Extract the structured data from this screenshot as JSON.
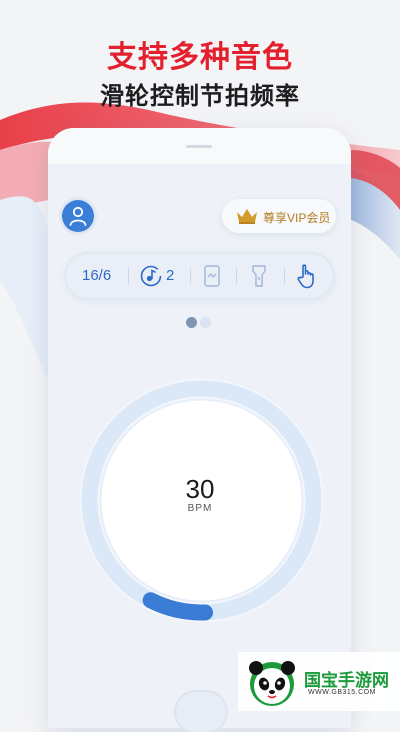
{
  "banner": {
    "title": "支持多种音色",
    "subtitle": "滑轮控制节拍频率"
  },
  "header": {
    "avatar_icon": "user-icon",
    "vip_icon": "crown-icon",
    "vip_label": "尊享VIP会员"
  },
  "toolbar": {
    "time_signature": "16/6",
    "subdivision_icon": "note-dial-icon",
    "subdivision_value": "2",
    "items": [
      "time-signature",
      "subdivision-icon",
      "vibrate-phone-icon",
      "flashlight-icon",
      "tap-hand-icon"
    ]
  },
  "pager": {
    "pages": 2,
    "active": 1
  },
  "metronome": {
    "bpm": "30",
    "unit": "BPM",
    "progress": 0.08
  },
  "watermark": {
    "name": "国宝手游网",
    "url": "WWW.GB315.COM"
  },
  "colors": {
    "accent": "#3b7ed8",
    "headline_red": "#e5202e",
    "vip_gold": "#b27c1c",
    "ring_track": "#dbe8f8"
  }
}
